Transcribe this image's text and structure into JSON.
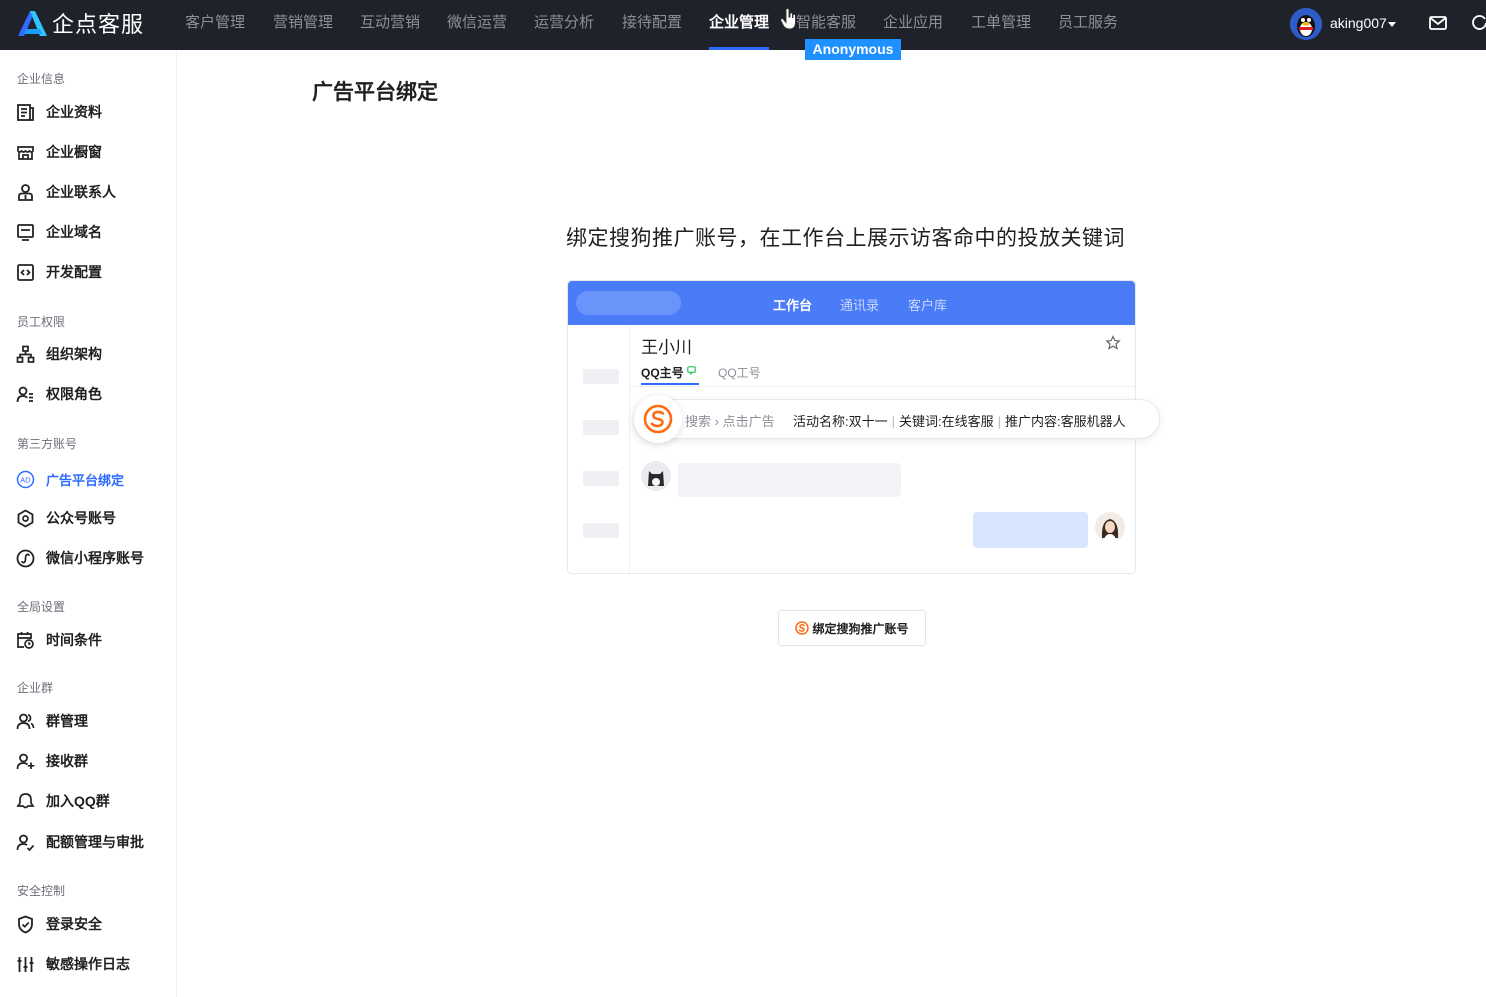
{
  "app": {
    "brand": "企点客服"
  },
  "topnav": {
    "items": [
      "客户管理",
      "营销管理",
      "互动营销",
      "微信运营",
      "运营分析",
      "接待配置",
      "企业管理",
      "智能客服",
      "企业应用",
      "工单管理",
      "员工服务"
    ],
    "active_index": 6,
    "anonymous_tag": "Anonymous",
    "user": "aking007"
  },
  "sidebar": {
    "groups": [
      {
        "title": "企业信息",
        "items": [
          "企业资料",
          "企业橱窗",
          "企业联系人",
          "企业域名",
          "开发配置"
        ]
      },
      {
        "title": "员工权限",
        "items": [
          "组织架构",
          "权限角色"
        ]
      },
      {
        "title": "第三方账号",
        "items": [
          "广告平台绑定",
          "公众号账号",
          "微信小程序账号"
        ]
      },
      {
        "title": "全局设置",
        "items": [
          "时间条件"
        ]
      },
      {
        "title": "企业群",
        "items": [
          "群管理",
          "接收群",
          "加入QQ群",
          "配额管理与审批"
        ]
      },
      {
        "title": "安全控制",
        "items": [
          "登录安全",
          "敏感操作日志"
        ]
      }
    ],
    "active_item": "广告平台绑定"
  },
  "main": {
    "title": "广告平台绑定",
    "headline": "绑定搜狗推广账号，在工作台上展示访客命中的投放关键词",
    "preview": {
      "tabs": [
        "工作台",
        "通讯录",
        "客户库"
      ],
      "contact_name": "王小川",
      "account_tabs": [
        "QQ主号",
        "QQ工号"
      ],
      "ad_path": [
        "搜索",
        "点击广告"
      ],
      "ad_fields": [
        "活动名称:双十一",
        "关键词:在线客服",
        "推广内容:客服机器人"
      ]
    },
    "bind_button": "绑定搜狗推广账号"
  },
  "colors": {
    "accent": "#2e6bff",
    "topbar": "#1f222b",
    "sogou": "#ff6a13",
    "preview_header": "#4a7cf7"
  }
}
